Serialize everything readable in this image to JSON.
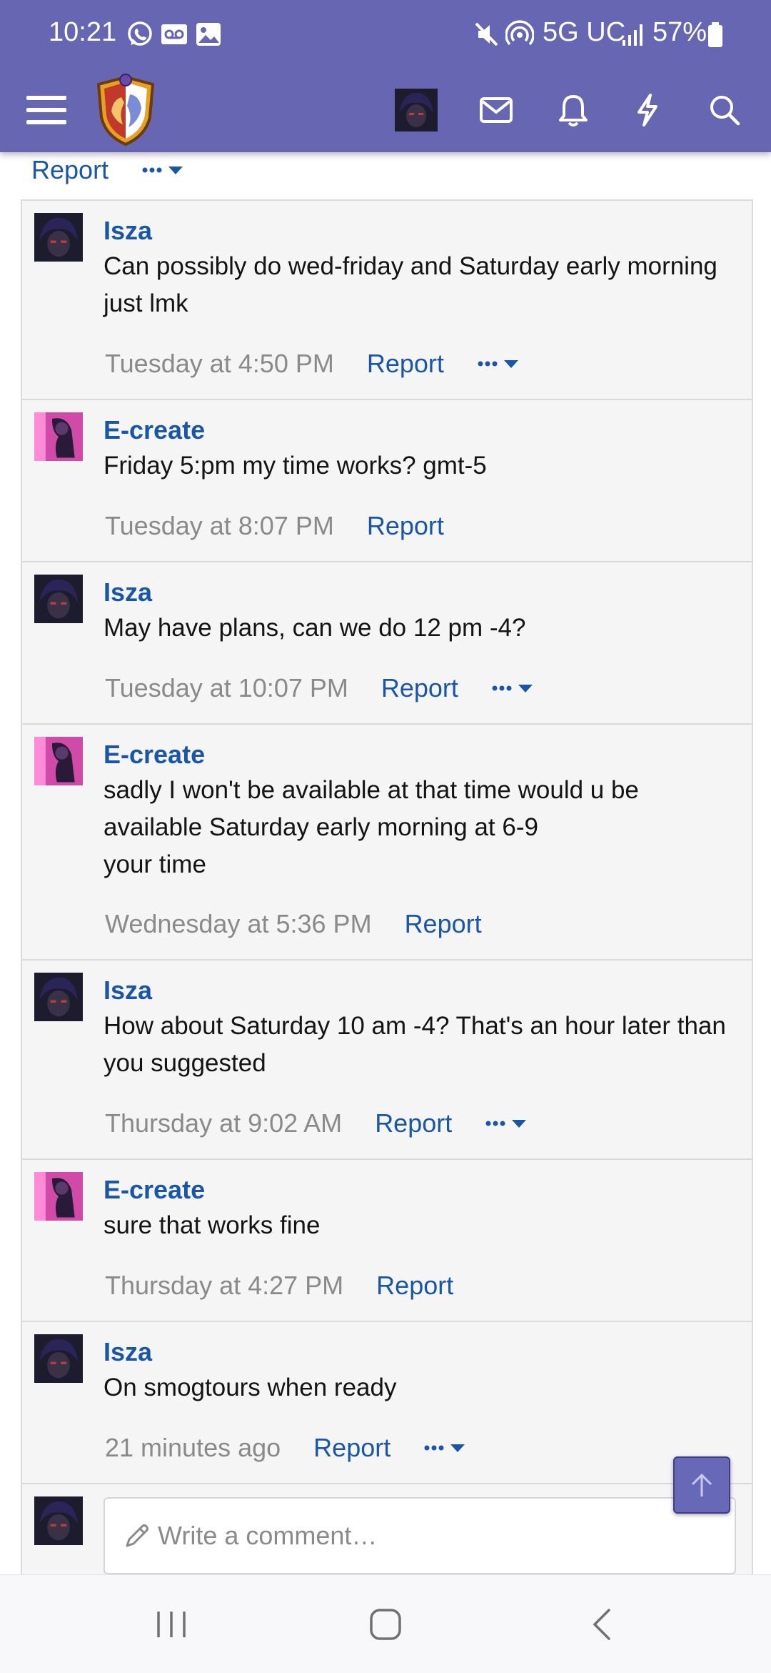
{
  "status_bar": {
    "time": "10:21",
    "network": "5G UC",
    "battery": "57%"
  },
  "nav": {
    "icons": [
      "menu-icon",
      "site-logo",
      "user-avatar",
      "inbox-icon",
      "alerts-bell-icon",
      "whats-new-bolt-icon",
      "search-icon"
    ]
  },
  "previous_footer": {
    "report_label": "Report"
  },
  "comments": [
    {
      "user": "Isza",
      "text": "Can possibly do wed-friday and Saturday early morning just lmk",
      "date": "Tuesday at 4:50 PM",
      "report": "Report",
      "has_more": true
    },
    {
      "user": "E-create",
      "text": "Friday 5:pm my time works? gmt-5",
      "date": "Tuesday at 8:07 PM",
      "report": "Report",
      "has_more": false
    },
    {
      "user": "Isza",
      "text": "May have plans, can we do 12 pm -4?",
      "date": "Tuesday at 10:07 PM",
      "report": "Report",
      "has_more": true
    },
    {
      "user": "E-create",
      "text": "sadly I won't be available at that time would u be available Saturday early morning at 6-9\nyour time",
      "date": "Wednesday at 5:36 PM",
      "report": "Report",
      "has_more": false
    },
    {
      "user": "Isza",
      "text": "How about Saturday 10 am -4? That's an hour later than you suggested",
      "date": "Thursday at 9:02 AM",
      "report": "Report",
      "has_more": true
    },
    {
      "user": "E-create",
      "text": "sure that works fine",
      "date": "Thursday at 4:27 PM",
      "report": "Report",
      "has_more": false
    },
    {
      "user": "Isza",
      "text": "On smogtours when ready",
      "date": "21 minutes ago",
      "report": "Report",
      "has_more": true
    }
  ],
  "composer": {
    "placeholder": "Write a comment…"
  },
  "colors": {
    "header": "#6666b2",
    "link": "#1a56a8",
    "meta": "#8a8a8a",
    "row_bg": "#f5f5f5"
  }
}
